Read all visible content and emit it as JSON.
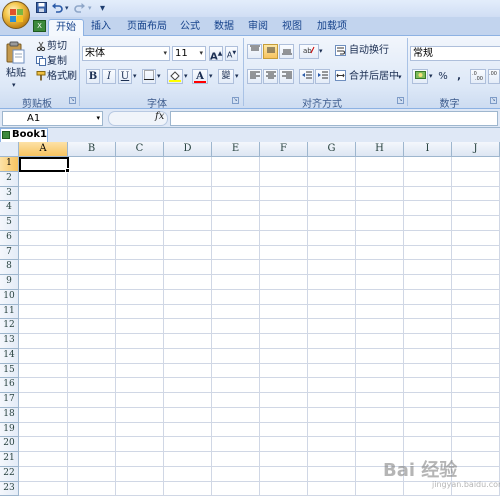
{
  "quick_access": {
    "customize_glyph": "▾"
  },
  "tabs": [
    {
      "label": "开始",
      "active": true
    },
    {
      "label": "插入"
    },
    {
      "label": "页面布局"
    },
    {
      "label": "公式"
    },
    {
      "label": "数据"
    },
    {
      "label": "审阅"
    },
    {
      "label": "视图"
    },
    {
      "label": "加载项"
    }
  ],
  "clipboard": {
    "paste_label": "粘贴",
    "cut_label": "剪切",
    "copy_label": "复制",
    "format_painter_label": "格式刷",
    "group_label": "剪贴板"
  },
  "font": {
    "family": "宋体",
    "size": "11",
    "grow_label": "A",
    "shrink_label": "A",
    "bold_label": "B",
    "italic_label": "I",
    "underline_label": "U",
    "font_color_label": "A",
    "phonetic_label": "變",
    "group_label": "字体"
  },
  "alignment": {
    "wrap_text_label": "自动换行",
    "merge_center_label": "合并后居中",
    "group_label": "对齐方式"
  },
  "number": {
    "format": "常规",
    "percent_label": "%",
    "comma_label": ",",
    "group_label": "数字"
  },
  "formula_bar": {
    "name_box": "A1",
    "fx_label": "fx",
    "formula": ""
  },
  "workbook": {
    "tab_label": "Book1"
  },
  "sheet": {
    "columns": [
      "A",
      "B",
      "C",
      "D",
      "E",
      "F",
      "G",
      "H",
      "I",
      "J"
    ],
    "rows": [
      "1",
      "2",
      "3",
      "4",
      "5",
      "6",
      "7",
      "8",
      "9",
      "10",
      "11",
      "12",
      "13",
      "14",
      "15",
      "16",
      "17",
      "18",
      "19",
      "20",
      "21",
      "22",
      "23"
    ],
    "active_cell": "A1"
  },
  "colors": {
    "ribbon_text": "#15428b",
    "selected_header": "#f7c35f",
    "grid_line": "#d0d7e5"
  },
  "watermark": {
    "text": "Bai 经验",
    "sub": "jingyan.baidu.com"
  }
}
